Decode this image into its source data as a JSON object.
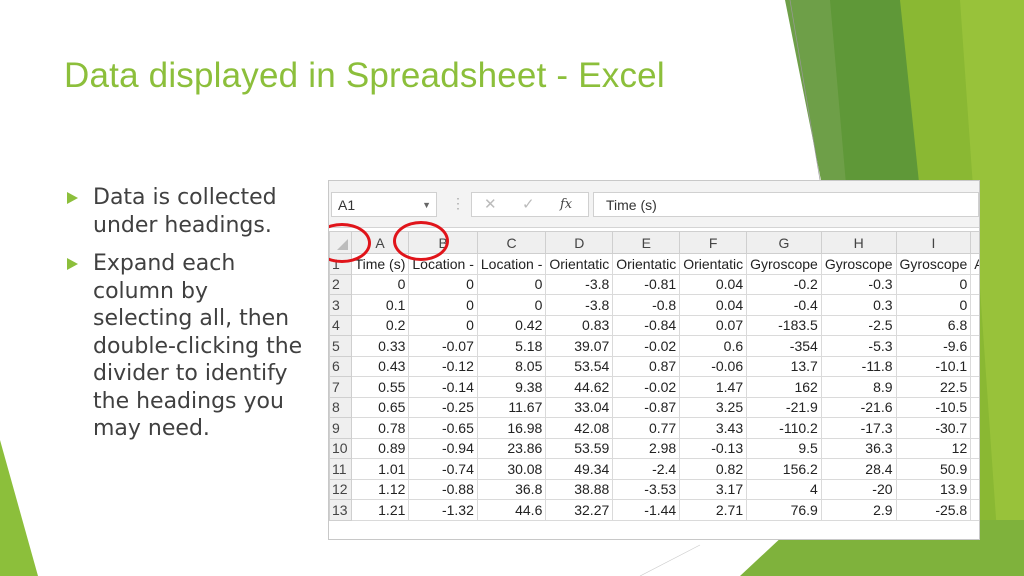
{
  "slide": {
    "title": "Data displayed in Spreadsheet - Excel",
    "bullets": [
      "Data is collected under headings.",
      "Expand each column by selecting all, then double-clicking the divider to identify the headings you may need."
    ],
    "accent_color": "#8cbf3b"
  },
  "excel": {
    "name_box": "A1",
    "formula_icons": [
      "cancel-icon",
      "enter-icon",
      "fx-icon"
    ],
    "fx_label": "fx",
    "formula": "Time (s)",
    "columns": [
      "A",
      "B",
      "C",
      "D",
      "E",
      "F",
      "G",
      "H",
      "I"
    ],
    "row_numbers": [
      "1",
      "2",
      "3",
      "4",
      "5",
      "6",
      "7",
      "8",
      "9",
      "10",
      "11",
      "12",
      "13"
    ],
    "header_row": [
      "Time (s)",
      "Location -",
      "Location -",
      "Orientatic",
      "Orientatic",
      "Orientatic",
      "Gyroscope",
      "Gyroscope",
      "Gyroscope",
      "A"
    ],
    "rows": [
      [
        "0",
        "0",
        "0",
        "-3.8",
        "-0.81",
        "0.04",
        "-0.2",
        "-0.3",
        "0"
      ],
      [
        "0.1",
        "0",
        "0",
        "-3.8",
        "-0.8",
        "0.04",
        "-0.4",
        "0.3",
        "0"
      ],
      [
        "0.2",
        "0",
        "0.42",
        "0.83",
        "-0.84",
        "0.07",
        "-183.5",
        "-2.5",
        "6.8"
      ],
      [
        "0.33",
        "-0.07",
        "5.18",
        "39.07",
        "-0.02",
        "0.6",
        "-354",
        "-5.3",
        "-9.6"
      ],
      [
        "0.43",
        "-0.12",
        "8.05",
        "53.54",
        "0.87",
        "-0.06",
        "13.7",
        "-11.8",
        "-10.1"
      ],
      [
        "0.55",
        "-0.14",
        "9.38",
        "44.62",
        "-0.02",
        "1.47",
        "162",
        "8.9",
        "22.5"
      ],
      [
        "0.65",
        "-0.25",
        "11.67",
        "33.04",
        "-0.87",
        "3.25",
        "-21.9",
        "-21.6",
        "-10.5"
      ],
      [
        "0.78",
        "-0.65",
        "16.98",
        "42.08",
        "0.77",
        "3.43",
        "-110.2",
        "-17.3",
        "-30.7"
      ],
      [
        "0.89",
        "-0.94",
        "23.86",
        "53.59",
        "2.98",
        "-0.13",
        "9.5",
        "36.3",
        "12"
      ],
      [
        "1.01",
        "-0.74",
        "30.08",
        "49.34",
        "-2.4",
        "0.82",
        "156.2",
        "28.4",
        "50.9"
      ],
      [
        "1.12",
        "-0.88",
        "36.8",
        "38.88",
        "-3.53",
        "3.17",
        "4",
        "-20",
        "13.9"
      ],
      [
        "1.21",
        "-1.32",
        "44.6",
        "32.27",
        "-1.44",
        "2.71",
        "76.9",
        "2.9",
        "-25.8"
      ]
    ],
    "highlight_color": "#e0141a"
  }
}
